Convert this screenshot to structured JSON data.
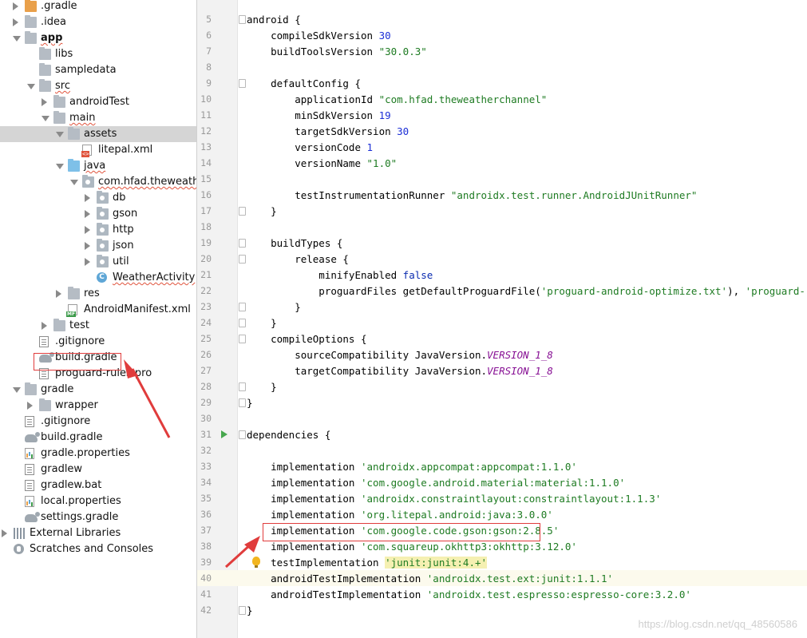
{
  "tree": {
    "items": [
      {
        "label": ".gradle",
        "depth": 1,
        "arrow": "right",
        "icon": "folder-orange-icon",
        "iconClass": "f-orange folder"
      },
      {
        "label": ".idea",
        "depth": 1,
        "arrow": "right",
        "icon": "folder-icon",
        "iconClass": "f-gray folder"
      },
      {
        "label": "app",
        "depth": 1,
        "arrow": "down",
        "icon": "module-folder-icon",
        "iconClass": "f-gray folder",
        "bold": true,
        "squiggle": true
      },
      {
        "label": "libs",
        "depth": 2,
        "arrow": "",
        "icon": "folder-icon",
        "iconClass": "f-gray folder"
      },
      {
        "label": "sampledata",
        "depth": 2,
        "arrow": "",
        "icon": "folder-icon",
        "iconClass": "f-gray folder"
      },
      {
        "label": "src",
        "depth": 2,
        "arrow": "down",
        "icon": "folder-icon",
        "iconClass": "f-gray folder",
        "squiggle": true
      },
      {
        "label": "androidTest",
        "depth": 3,
        "arrow": "right",
        "icon": "folder-icon",
        "iconClass": "f-gray folder"
      },
      {
        "label": "main",
        "depth": 3,
        "arrow": "down",
        "icon": "folder-icon",
        "iconClass": "f-gray folder",
        "squiggle": true
      },
      {
        "label": "assets",
        "depth": 4,
        "arrow": "down",
        "icon": "assets-folder-icon",
        "iconClass": "f-gray folder",
        "selected": true
      },
      {
        "label": "litepal.xml",
        "depth": 5,
        "arrow": "",
        "icon": "xml-file-icon",
        "iconClass": "xml-ico"
      },
      {
        "label": "java",
        "depth": 4,
        "arrow": "down",
        "icon": "source-folder-icon",
        "iconClass": "f-blue folder",
        "squiggle": true
      },
      {
        "label": "com.hfad.theweather",
        "depth": 5,
        "arrow": "down",
        "icon": "package-icon",
        "iconClass": "f-src folder pkg",
        "squiggle": true
      },
      {
        "label": "db",
        "depth": 6,
        "arrow": "right",
        "icon": "package-icon",
        "iconClass": "f-src folder pkg"
      },
      {
        "label": "gson",
        "depth": 6,
        "arrow": "right",
        "icon": "package-icon",
        "iconClass": "f-src folder pkg"
      },
      {
        "label": "http",
        "depth": 6,
        "arrow": "right",
        "icon": "package-icon",
        "iconClass": "f-src folder pkg"
      },
      {
        "label": "json",
        "depth": 6,
        "arrow": "right",
        "icon": "package-icon",
        "iconClass": "f-src folder pkg"
      },
      {
        "label": "util",
        "depth": 6,
        "arrow": "right",
        "icon": "package-icon",
        "iconClass": "f-src folder pkg"
      },
      {
        "label": "WeatherActivity",
        "depth": 6,
        "arrow": "",
        "icon": "class-icon",
        "iconClass": "class-ico",
        "squiggle": true
      },
      {
        "label": "res",
        "depth": 4,
        "arrow": "right",
        "icon": "res-folder-icon",
        "iconClass": "f-gray folder"
      },
      {
        "label": "AndroidManifest.xml",
        "depth": 4,
        "arrow": "",
        "icon": "manifest-file-icon",
        "iconClass": "mf-ico"
      },
      {
        "label": "test",
        "depth": 3,
        "arrow": "right",
        "icon": "folder-icon",
        "iconClass": "f-gray folder"
      },
      {
        "label": ".gitignore",
        "depth": 2,
        "arrow": "",
        "icon": "text-file-icon",
        "iconClass": "file-doc"
      },
      {
        "label": "build.gradle",
        "depth": 2,
        "arrow": "",
        "icon": "gradle-icon",
        "iconClass": "gradle-ico"
      },
      {
        "label": "proguard-rules.pro",
        "depth": 2,
        "arrow": "",
        "icon": "text-file-icon",
        "iconClass": "file-doc"
      },
      {
        "label": "gradle",
        "depth": 1,
        "arrow": "down",
        "icon": "folder-icon",
        "iconClass": "f-gray folder"
      },
      {
        "label": "wrapper",
        "depth": 2,
        "arrow": "right",
        "icon": "folder-icon",
        "iconClass": "f-gray folder"
      },
      {
        "label": ".gitignore",
        "depth": 1,
        "arrow": "",
        "icon": "text-file-icon",
        "iconClass": "file-doc"
      },
      {
        "label": "build.gradle",
        "depth": 1,
        "arrow": "",
        "icon": "gradle-icon",
        "iconClass": "gradle-ico"
      },
      {
        "label": "gradle.properties",
        "depth": 1,
        "arrow": "",
        "icon": "properties-file-icon",
        "iconClass": "props-ico"
      },
      {
        "label": "gradlew",
        "depth": 1,
        "arrow": "",
        "icon": "text-file-icon",
        "iconClass": "file-doc"
      },
      {
        "label": "gradlew.bat",
        "depth": 1,
        "arrow": "",
        "icon": "text-file-icon",
        "iconClass": "file-doc"
      },
      {
        "label": "local.properties",
        "depth": 1,
        "arrow": "",
        "icon": "properties-file-icon",
        "iconClass": "props-ico"
      },
      {
        "label": "settings.gradle",
        "depth": 1,
        "arrow": "",
        "icon": "gradle-icon",
        "iconClass": "gradle-ico"
      },
      {
        "label": "External Libraries",
        "depth": 0,
        "arrow": "right",
        "icon": "libraries-icon",
        "iconClass": "lib-ico"
      },
      {
        "label": "Scratches and Consoles",
        "depth": 0,
        "arrow": "",
        "icon": "scratches-icon",
        "iconClass": "scratch-ico"
      }
    ]
  },
  "editor": {
    "current_line": 40,
    "lines": [
      {
        "n": "5",
        "fold": true,
        "html": "android {"
      },
      {
        "n": "6",
        "html": "    compileSdkVersion <span class=\"n\">30</span>"
      },
      {
        "n": "7",
        "html": "    buildToolsVersion <span class=\"s\">\"30.0.3\"</span>"
      },
      {
        "n": "8",
        "html": ""
      },
      {
        "n": "9",
        "fold": true,
        "html": "    defaultConfig {"
      },
      {
        "n": "10",
        "html": "        applicationId <span class=\"s\">\"com.hfad.theweatherchannel\"</span>"
      },
      {
        "n": "11",
        "html": "        minSdkVersion <span class=\"n\">19</span>"
      },
      {
        "n": "12",
        "html": "        targetSdkVersion <span class=\"n\">30</span>"
      },
      {
        "n": "13",
        "html": "        versionCode <span class=\"n\">1</span>"
      },
      {
        "n": "14",
        "html": "        versionName <span class=\"s\">\"1.0\"</span>"
      },
      {
        "n": "15",
        "html": ""
      },
      {
        "n": "16",
        "html": "        testInstrumentationRunner <span class=\"s\">\"androidx.test.runner.AndroidJUnitRunner\"</span>"
      },
      {
        "n": "17",
        "fold": true,
        "html": "    }"
      },
      {
        "n": "18",
        "html": ""
      },
      {
        "n": "19",
        "fold": true,
        "html": "    buildTypes {"
      },
      {
        "n": "20",
        "fold": true,
        "html": "        release {"
      },
      {
        "n": "21",
        "html": "            minifyEnabled <span class=\"k\">false</span>"
      },
      {
        "n": "22",
        "html": "            proguardFiles getDefaultProguardFile(<span class=\"s\">'proguard-android-optimize.txt'</span>), <span class=\"s\">'proguard-rules.pro'</span>"
      },
      {
        "n": "23",
        "fold": true,
        "html": "        }"
      },
      {
        "n": "24",
        "fold": true,
        "html": "    }"
      },
      {
        "n": "25",
        "fold": true,
        "html": "    compileOptions {"
      },
      {
        "n": "26",
        "html": "        sourceCompatibility JavaVersion.<span class=\"c\">VERSION_1_8</span>"
      },
      {
        "n": "27",
        "html": "        targetCompatibility JavaVersion.<span class=\"c\">VERSION_1_8</span>"
      },
      {
        "n": "28",
        "fold": true,
        "html": "    }"
      },
      {
        "n": "29",
        "fold": true,
        "html": "}"
      },
      {
        "n": "30",
        "html": ""
      },
      {
        "n": "31",
        "fold": true,
        "run": true,
        "html": "dependencies {"
      },
      {
        "n": "32",
        "html": ""
      },
      {
        "n": "33",
        "html": "    implementation <span class=\"s\">'androidx.appcompat:appcompat:1.1.0'</span>"
      },
      {
        "n": "34",
        "html": "    implementation <span class=\"s\">'com.google.android.material:material:1.1.0'</span>"
      },
      {
        "n": "35",
        "html": "    implementation <span class=\"s\">'androidx.constraintlayout:constraintlayout:1.1.3'</span>"
      },
      {
        "n": "36",
        "html": "    implementation <span class=\"s\">'org.litepal.android:java:3.0.0'</span>"
      },
      {
        "n": "37",
        "html": "    implementation <span class=\"s\">'com.google.code.gson:gson:2.8.5'</span>"
      },
      {
        "n": "38",
        "html": "    implementation <span class=\"s\">'com.squareup.okhttp3:okhttp:3.12.0'</span>"
      },
      {
        "n": "39",
        "bulb": true,
        "html": "    testImplementation <span class=\"s hl\">'junit:junit:4.+'</span>"
      },
      {
        "n": "40",
        "html": "    androidTestImplementation <span class=\"s\">'androidx.test.ext:junit:1.1.1'</span>"
      },
      {
        "n": "41",
        "html": "    androidTestImplementation <span class=\"s\">'androidx.test.espresso:espresso-core:3.2.0'</span>"
      },
      {
        "n": "42",
        "fold": true,
        "html": "}"
      }
    ]
  },
  "watermark": "https://blog.csdn.net/qq_48560586",
  "colors": {
    "annotation_red": "#e03c3c",
    "string_green": "#1e7b22",
    "number_blue": "#1c2fd6",
    "constant_purple": "#871094",
    "selection_gray": "#d5d5d5"
  }
}
